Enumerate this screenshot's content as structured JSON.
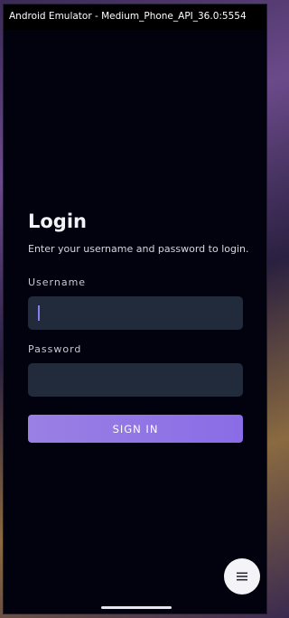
{
  "window": {
    "title": "Android Emulator - Medium_Phone_API_36.0:5554"
  },
  "login": {
    "title": "Login",
    "subtitle": "Enter your username and password to login.",
    "username": {
      "label": "Username",
      "value": "",
      "placeholder": ""
    },
    "password": {
      "label": "Password",
      "value": "",
      "placeholder": ""
    },
    "signin_label": "SIGN IN"
  },
  "fab": {
    "icon": "menu-icon"
  },
  "colors": {
    "background": "#02020f",
    "input_background": "#222b3c",
    "accent": "#8a6ce6",
    "text": "#f2f2f7"
  }
}
